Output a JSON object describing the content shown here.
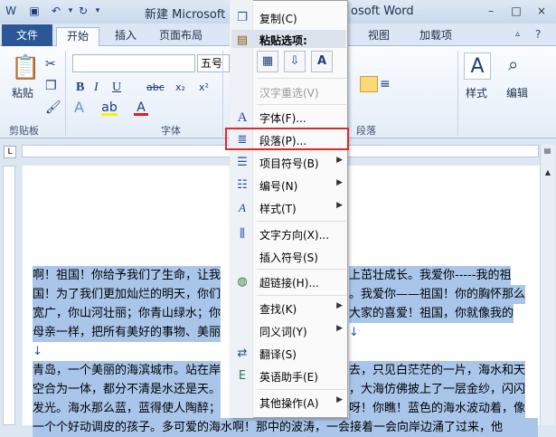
{
  "titlebar": {
    "title": "新建 Microsoft W...soft Word",
    "title_left": "新建 Microsoft W",
    "title_right": "osoft Word"
  },
  "quick_access": {
    "save_icon": "save-icon",
    "undo_icon": "undo-icon",
    "redo_icon": "redo-icon"
  },
  "window_controls": {
    "minimize": "–",
    "maximize": "□",
    "close": "×"
  },
  "tabs": [
    {
      "label": "文件"
    },
    {
      "label": "开始"
    },
    {
      "label": "插入"
    },
    {
      "label": "页面布局"
    },
    {
      "label": "视图"
    },
    {
      "label": "加载项"
    }
  ],
  "ribbon": {
    "paste_label": "粘贴",
    "font_size_value": "五号",
    "style_label": "样式",
    "edit_label": "编辑",
    "groups": {
      "clipboard": "剪贴板",
      "font": "字体",
      "paragraph": "段落"
    },
    "format_buttons": [
      "B",
      "I",
      "U",
      "abc",
      "x₂",
      "x²"
    ]
  },
  "context_menu": {
    "items": {
      "copy": "复制(C)",
      "paste_options": "粘贴选项:",
      "hanzi_reselect": "汉字重选(V)",
      "font": "字体(F)...",
      "paragraph": "段落(P)...",
      "bullets": "项目符号(B)",
      "numbering": "编号(N)",
      "styles": "样式(T)",
      "text_direction": "文字方向(X)...",
      "insert_symbol": "插入符号(S)",
      "hyperlink": "超链接(H)...",
      "lookup": "查找(K)",
      "synonyms": "同义词(Y)",
      "translate": "翻译(S)",
      "english_assistant": "英语助手(E)",
      "other_actions": "其他操作(A)"
    }
  },
  "document": {
    "lines": [
      {
        "left": "啊！祖国！你给予我们了生命，让我",
        "right": "上茁壮成长。我爱你-----我的祖"
      },
      {
        "left": "国！为了我们更加灿烂的明天，你们",
        "right": "。我爱你——祖国！你的胸怀那么"
      },
      {
        "left": "宽广，你山河壮丽；你青山绿水；你",
        "right": "大家的喜爱！祖国，你就像我的"
      },
      {
        "left": "母亲一样，把所有美好的事物、美丽",
        "right": "↓"
      },
      {
        "left": "↓",
        "right": ""
      },
      {
        "left": "青岛，一个美丽的海滨城市。站在岸",
        "right": "去，只见白茫茫的一片，海水和天"
      },
      {
        "left": "空合为一体，都分不清是水还是天。",
        "right": "，大海仿佛披上了一层金纱，闪闪"
      },
      {
        "left": "发光。海水那么蓝，蓝得使人陶醉；",
        "right": "呀！你瞧！蓝色的海水波动着，像"
      },
      {
        "left": "一个个好动调皮的孩子。多可爱的海水啊！那中的波涛，一会接着一会向岸边涌了过来，他",
        "right": ""
      }
    ]
  }
}
